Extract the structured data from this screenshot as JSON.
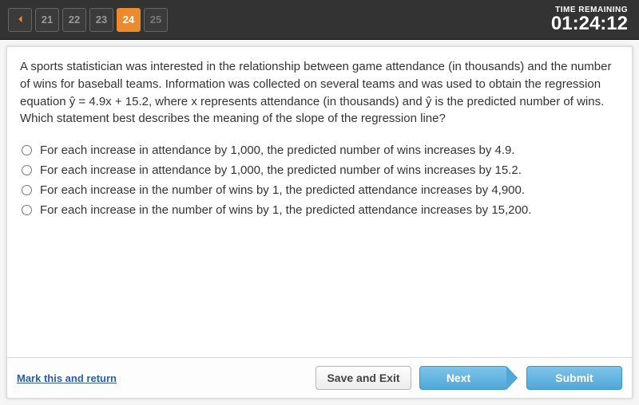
{
  "header": {
    "back_icon": "chevron-left",
    "nav": [
      {
        "num": "21",
        "state": "past"
      },
      {
        "num": "22",
        "state": "past"
      },
      {
        "num": "23",
        "state": "past"
      },
      {
        "num": "24",
        "state": "current"
      },
      {
        "num": "25",
        "state": "future"
      }
    ],
    "timer_label": "TIME REMAINING",
    "timer_value": "01:24:12"
  },
  "question": {
    "stem": "A sports statistician was interested in the relationship between game attendance (in thousands) and the number of wins for baseball teams. Information was collected on several teams and was used to obtain the regression equation ŷ = 4.9x + 15.2, where x represents attendance (in thousands) and ŷ is the predicted number of wins. Which statement best describes the meaning of the slope of the regression line?",
    "options": [
      "For each increase in attendance by 1,000, the predicted number of wins increases by 4.9.",
      "For each increase in attendance by 1,000, the predicted number of wins increases by 15.2.",
      "For each increase in the number of wins by 1, the predicted attendance increases by 4,900.",
      "For each increase in the number of wins by 1, the predicted attendance increases by 15,200."
    ]
  },
  "footer": {
    "mark_label": "Mark this and return",
    "save_exit_label": "Save and Exit",
    "next_label": "Next",
    "submit_label": "Submit"
  }
}
